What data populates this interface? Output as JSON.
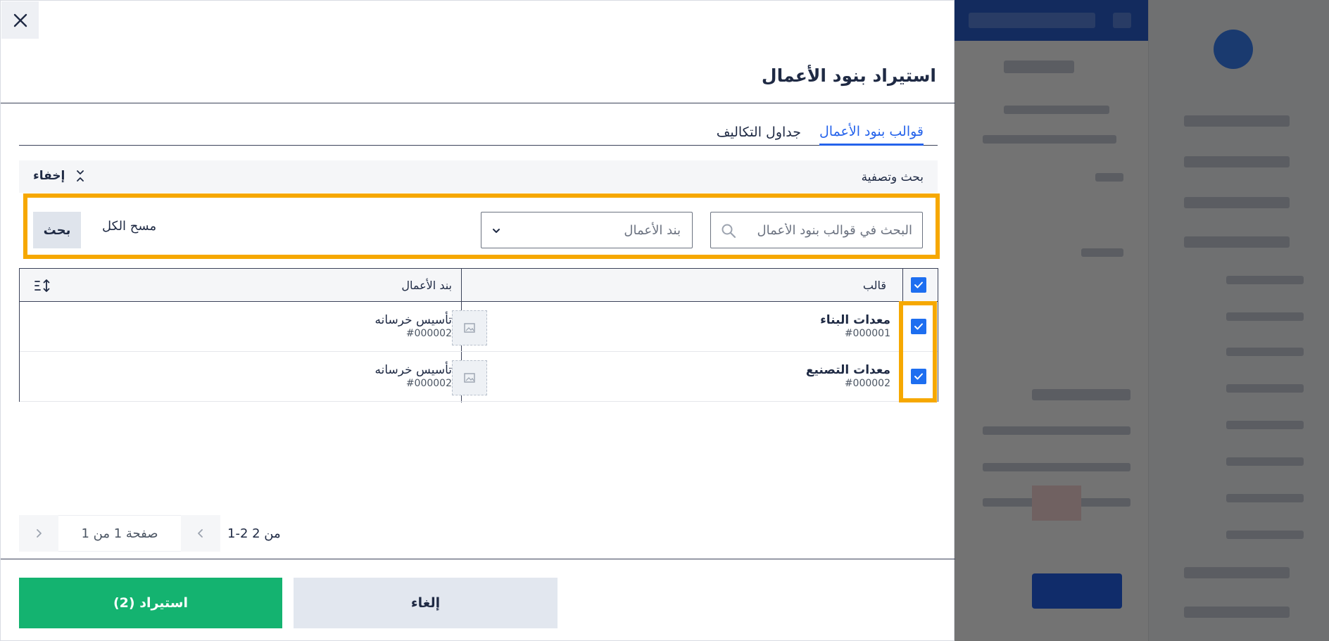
{
  "modal": {
    "title": "استيراد بنود الأعمال",
    "close_icon": "close-icon"
  },
  "tabs": [
    {
      "label": "قوالب بنود الأعمال",
      "active": true
    },
    {
      "label": "جداول التكاليف",
      "active": false
    }
  ],
  "filters": {
    "section_title": "بحث وتصفية",
    "hide_label": "إخفاء",
    "search_placeholder": "البحث في قوالب بنود الأعمال",
    "select_placeholder": "بند الأعمال",
    "clear_label": "مسح الكل",
    "search_label": "بحث"
  },
  "table": {
    "headers": {
      "template": "قالب",
      "work_item": "بند الأعمال"
    },
    "rows": [
      {
        "template_name": "معدات البناء",
        "template_code": "#000001",
        "item_name": "تأسيس خرسانه",
        "item_code": "#000002",
        "checked": true
      },
      {
        "template_name": "معدات التصنيع",
        "template_code": "#000002",
        "item_name": "تأسيس خرسانه",
        "item_code": "#000002",
        "checked": true
      }
    ]
  },
  "pagination": {
    "range": "1-2 من 2",
    "page_label": "صفحة 1 من 1"
  },
  "footer": {
    "cancel_label": "إلغاء",
    "import_label": "استيراد (2)"
  },
  "colors": {
    "accent": "#2563eb",
    "highlight": "#f6a800",
    "success": "#14b370",
    "checkbox": "#1d6ef0"
  }
}
